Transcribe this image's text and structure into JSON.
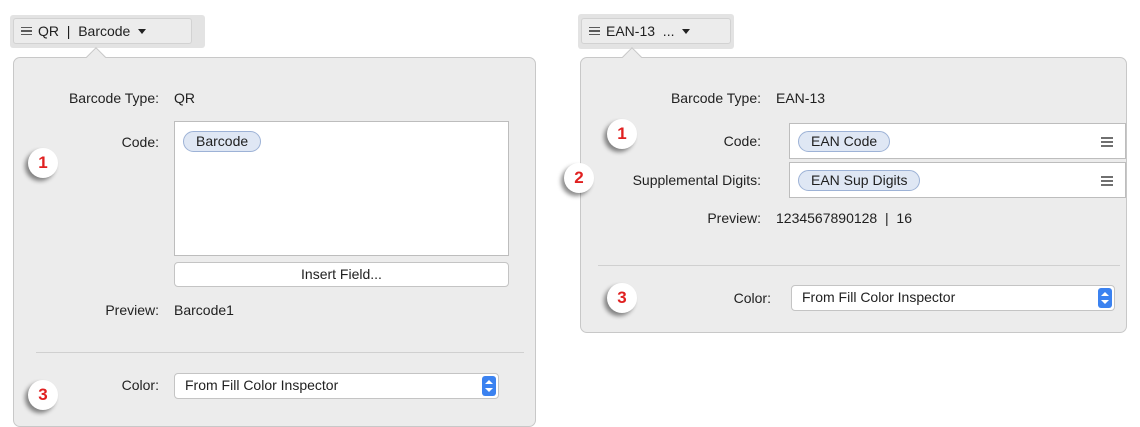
{
  "left": {
    "header_label": "QR  |  Barcode",
    "barcode_type_label": "Barcode Type:",
    "barcode_type_value": "QR",
    "code_label": "Code:",
    "code_token": "Barcode",
    "insert_field_button": "Insert Field...",
    "preview_label": "Preview:",
    "preview_value": "Barcode1",
    "color_label": "Color:",
    "color_value": "From Fill Color Inspector",
    "callouts": [
      "1",
      "3"
    ]
  },
  "right": {
    "header_label": "EAN-13  ...",
    "barcode_type_label": "Barcode Type:",
    "barcode_type_value": "EAN-13",
    "code_label": "Code:",
    "code_token": "EAN Code",
    "supplemental_label": "Supplemental Digits:",
    "supplemental_token": "EAN Sup Digits",
    "preview_label": "Preview:",
    "preview_value": "1234567890128  |  16",
    "color_label": "Color:",
    "color_value": "From Fill Color Inspector",
    "callouts": [
      "1",
      "2",
      "3"
    ]
  },
  "colors": {
    "panel_bg": "#ececec",
    "token_bg": "#dfe7f4",
    "token_border": "#9db2d6",
    "accent_blue": "#3b82f0",
    "callout_red": "#e02020"
  }
}
